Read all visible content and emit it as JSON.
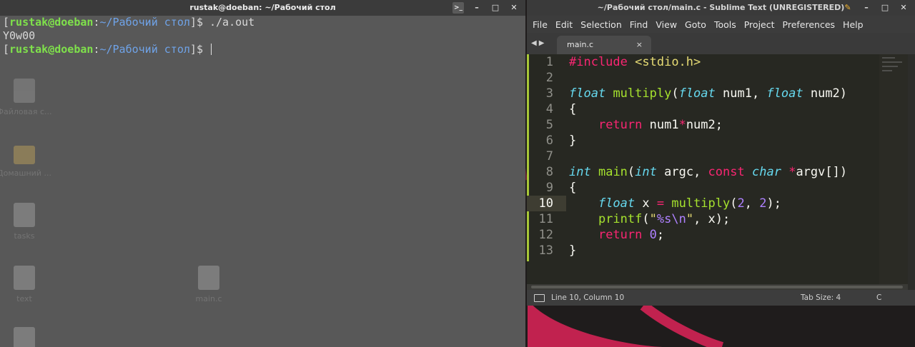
{
  "terminal": {
    "title": "rustak@doeban: ~/Рабочий стол",
    "lines": [
      {
        "user": "rustak@doeban",
        "sep": ":",
        "path": "~/Рабочий стол",
        "cmd": "$ ./a.out"
      },
      {
        "output": "Y0w00"
      },
      {
        "user": "rustak@doeban",
        "sep": ":",
        "path": "~/Рабочий стол",
        "cmd": "$ "
      }
    ]
  },
  "desktop_icons": [
    {
      "label": "Файловая с..."
    },
    {
      "label": "Домашний ..."
    },
    {
      "label": "tasks"
    },
    {
      "label": "text"
    },
    {
      "label": "main.c"
    }
  ],
  "sublime": {
    "title": "~/Рабочий стол/main.c - Sublime Text (UNREGISTERED)",
    "menu": [
      "File",
      "Edit",
      "Selection",
      "Find",
      "View",
      "Goto",
      "Tools",
      "Project",
      "Preferences",
      "Help"
    ],
    "tab": {
      "label": "main.c",
      "close": "×"
    },
    "status": {
      "position": "Line 10, Column 10",
      "tab_size": "Tab Size: 4",
      "syntax": "C"
    },
    "active_line": 10,
    "line_numbers": [
      "1",
      "2",
      "3",
      "4",
      "5",
      "6",
      "7",
      "8",
      "9",
      "10",
      "11",
      "12",
      "13"
    ]
  },
  "colors": {
    "terminal_bg": "#585858",
    "prompt_user": "#7fe14b",
    "prompt_path": "#6fa3e8",
    "editor_bg": "#272822",
    "desktop_accent": "#c1224f"
  }
}
